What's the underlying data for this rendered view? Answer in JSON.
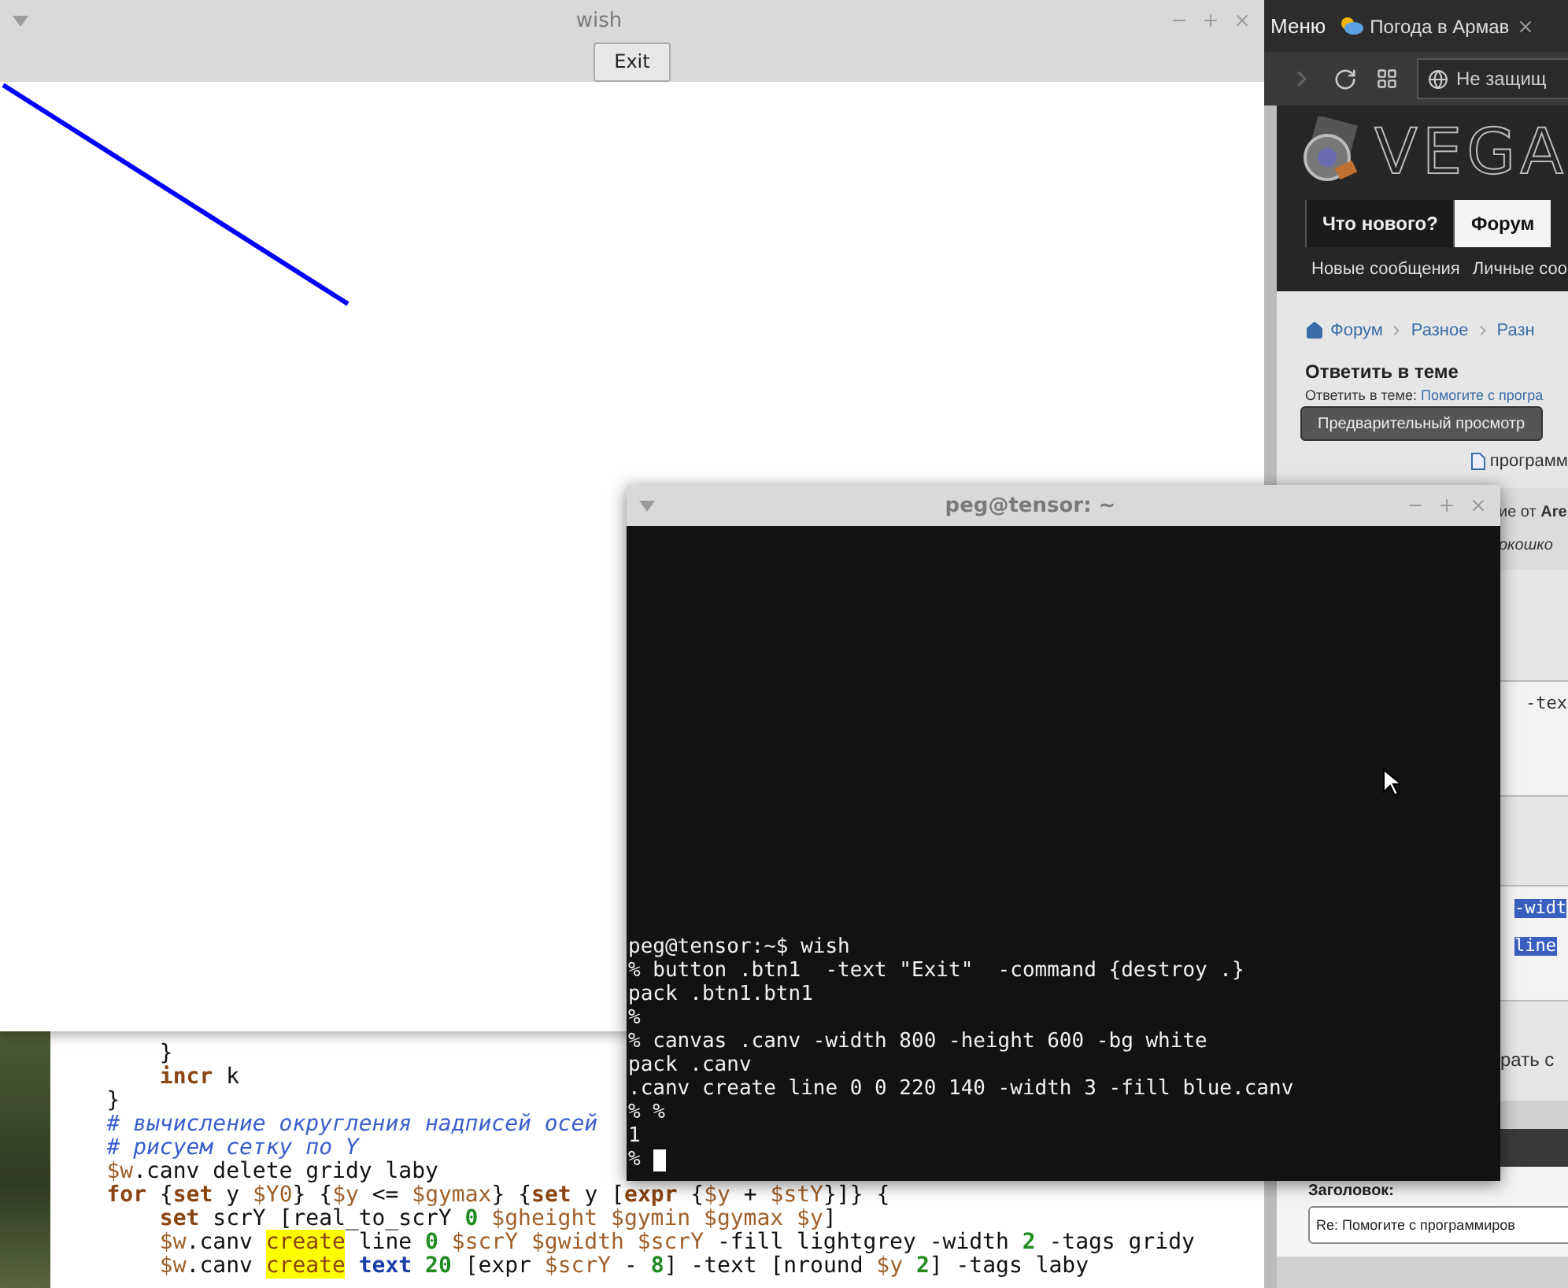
{
  "editor": {
    "lines": [
      [
        {
          "text": "        }",
          "kind": "plain"
        }
      ],
      [
        {
          "text": "        incr",
          "kind": "keyword"
        },
        {
          "text": " k",
          "kind": "plain"
        }
      ],
      [
        {
          "text": "    }",
          "kind": "plain"
        }
      ],
      [
        {
          "text": "    # вычисление округления надписей осей",
          "kind": "comment"
        }
      ],
      [
        {
          "text": "    # рисуем сетку по Y",
          "kind": "comment"
        }
      ],
      [
        {
          "text": "    $w",
          "kind": "variable"
        },
        {
          "text": ".canv delete gridy laby",
          "kind": "plain"
        }
      ],
      [
        {
          "text": "    for",
          "kind": "keyword"
        },
        {
          "text": " {",
          "kind": "plain"
        },
        {
          "text": "set",
          "kind": "keyword"
        },
        {
          "text": " y ",
          "kind": "plain"
        },
        {
          "text": "$Y0",
          "kind": "variable"
        },
        {
          "text": "} {",
          "kind": "plain"
        },
        {
          "text": "$y",
          "kind": "variable"
        },
        {
          "text": " <= ",
          "kind": "plain"
        },
        {
          "text": "$gymax",
          "kind": "variable"
        },
        {
          "text": "} {",
          "kind": "plain"
        },
        {
          "text": "set",
          "kind": "keyword"
        },
        {
          "text": " y [",
          "kind": "plain"
        },
        {
          "text": "expr",
          "kind": "keyword"
        },
        {
          "text": " {",
          "kind": "plain"
        },
        {
          "text": "$y",
          "kind": "variable"
        },
        {
          "text": " + ",
          "kind": "plain"
        },
        {
          "text": "$stY",
          "kind": "variable"
        },
        {
          "text": "}]} {",
          "kind": "plain"
        }
      ],
      [
        {
          "text": "        set",
          "kind": "keyword"
        },
        {
          "text": " scrY [real_to_scrY ",
          "kind": "plain"
        },
        {
          "text": "0",
          "kind": "number"
        },
        {
          "text": " $gheight $gymin $gymax $y",
          "kind": "variable"
        },
        {
          "text": "]",
          "kind": "plain"
        }
      ],
      [
        {
          "text": "        $w",
          "kind": "variable"
        },
        {
          "text": ".canv ",
          "kind": "plain"
        },
        {
          "text": "create",
          "kind": "highlight"
        },
        {
          "text": " line ",
          "kind": "plain"
        },
        {
          "text": "0",
          "kind": "number"
        },
        {
          "text": " $scrY $gwidth $scrY",
          "kind": "variable"
        },
        {
          "text": " -fill lightgrey -width ",
          "kind": "plain"
        },
        {
          "text": "2",
          "kind": "number"
        },
        {
          "text": " -tags gridy",
          "kind": "plain"
        }
      ],
      [
        {
          "text": "        $w",
          "kind": "variable"
        },
        {
          "text": ".canv ",
          "kind": "plain"
        },
        {
          "text": "create",
          "kind": "highlight"
        },
        {
          "text": " text",
          "kind": "command"
        },
        {
          "text": " 20",
          "kind": "number"
        },
        {
          "text": " [expr ",
          "kind": "plain"
        },
        {
          "text": "$scrY",
          "kind": "variable"
        },
        {
          "text": " - ",
          "kind": "plain"
        },
        {
          "text": "8",
          "kind": "number"
        },
        {
          "text": "] -text [nround ",
          "kind": "plain"
        },
        {
          "text": "$y",
          "kind": "variable"
        },
        {
          "text": " 2",
          "kind": "number"
        },
        {
          "text": "] -tags laby",
          "kind": "plain"
        }
      ]
    ]
  },
  "wish_window": {
    "title": "wish",
    "exit_button": "Exit"
  },
  "browser": {
    "menu": "Меню",
    "tab_title": "Погода в Армав",
    "address": "Не защищ",
    "logo_text": "VEGA",
    "nav": [
      {
        "label": "Что нового?",
        "selected": false
      },
      {
        "label": "Форум",
        "selected": true
      }
    ],
    "subnav": [
      "Новые сообщения",
      "Личные соо"
    ],
    "breadcrumb": [
      "Форум",
      "Разное",
      "Разн"
    ],
    "heading": "Ответить в теме",
    "reply_label": "Ответить в теме:",
    "reply_link": "Помогите с програ",
    "preview_button": "Предварительный просмотр",
    "post_title": "программ",
    "quote_author": "ие от **Are**",
    "quote_text": "окошко",
    "blocks": [
      {
        "selected": false,
        "lines": [
          "-tex"
        ]
      },
      {
        "selected": true,
        "lines": [
          "-widt",
          "line"
        ]
      }
    ],
    "after_text": "рать с",
    "title_label": "Заголовок:",
    "title_value": "Re: Помогите с программиров"
  },
  "terminal": {
    "title": "peg@tensor: ~",
    "lines": [
      "peg@tensor:~$ wish",
      "% button .btn1  -text \"Exit\"  -command {destroy .}",
      "pack .btn1.btn1",
      "%",
      "% canvas .canv -width 800 -height 600 -bg white",
      "pack .canv",
      ".canv create line 0 0 220 140 -width 3 -fill blue.canv",
      "% %",
      "1",
      "%"
    ]
  }
}
